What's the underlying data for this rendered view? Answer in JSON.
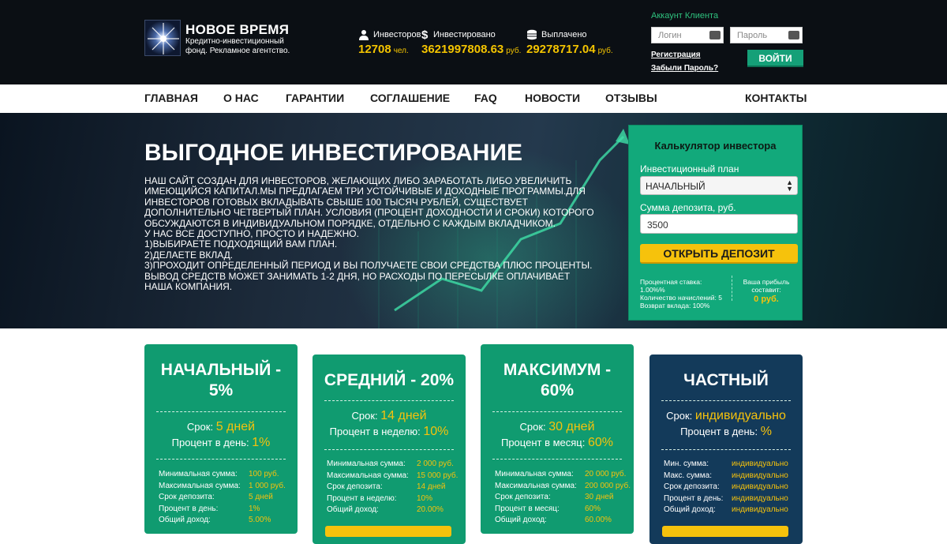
{
  "header": {
    "logo_title": "НОВОЕ ВРЕМЯ",
    "logo_subtitle": "Кредитно-инвестиционный фонд. Рекламное агентство.",
    "stats": [
      {
        "icon": "user-icon",
        "label": "Инвесторов",
        "value": "12708",
        "unit": "чел."
      },
      {
        "icon": "dollar-icon",
        "label": "Инвестировано",
        "value": "3621997808.63",
        "unit": "руб."
      },
      {
        "icon": "coins-icon",
        "label": "Выплачено",
        "value": "29278717.04",
        "unit": "руб."
      }
    ],
    "account": {
      "title": "Аккаунт Клиента",
      "login_placeholder": "Логин",
      "password_placeholder": "Пароль",
      "register_link": "Регистрация",
      "forgot_link": "Забыли Пароль?",
      "login_button": "ВОЙТИ"
    }
  },
  "nav": {
    "items": [
      "ГЛАВНАЯ",
      "О НАС",
      "ГАРАНТИИ",
      "СОГЛАШЕНИЕ",
      "FAQ",
      "НОВОСТИ",
      "ОТЗЫВЫ",
      "КОНТАКТЫ"
    ]
  },
  "hero": {
    "title": "ВЫГОДНОЕ ИНВЕСТИРОВАНИЕ",
    "text": "НАШ САЙТ СОЗДАН ДЛЯ ИНВЕСТОРОВ, ЖЕЛАЮЩИХ ЛИБО ЗАРАБОТАТЬ ЛИБО УВЕЛИЧИТЬ\nИМЕЮЩИЙСЯ КАПИТАЛ.МЫ ПРЕДЛАГАЕМ ТРИ УСТОЙЧИВЫЕ И ДОХОДНЫЕ ПРОГРАММЫ.ДЛЯ\nИНВЕСТОРОВ ГОТОВЫХ ВКЛАДЫВАТЬ СВЫШЕ 100 ТЫСЯЧ РУБЛЕЙ, СУЩЕСТВУЕТ\nДОПОЛНИТЕЛЬНО ЧЕТВЕРТЫЙ ПЛАН. УСЛОВИЯ (ПРОЦЕНТ ДОХОДНОСТИ И СРОКИ) КОТОРОГО\nОБСУЖДАЮТСЯ В ИНДИВИДУАЛЬНОМ ПОРЯДКЕ, ОТДЕЛЬНО С КАЖДЫМ ВКЛАДЧИКОМ.\nУ НАС ВСЕ ДОСТУПНО, ПРОСТО И НАДЕЖНО.\n1)ВЫБИРАЕТЕ ПОДХОДЯЩИЙ ВАМ ПЛАН.\n2)ДЕЛАЕТЕ ВКЛАД.\n3)ПРОХОДИТ ОПРЕДЕЛЕННЫЙ ПЕРИОД И ВЫ ПОЛУЧАЕТЕ СВОИ СРЕДСТВА ПЛЮС ПРОЦЕНТЫ.\nВЫВОД СРЕДСТВ МОЖЕТ ЗАНИМАТЬ 1-2 ДНЯ, НО РАСХОДЫ ПО ПЕРЕСЫЛКЕ ОПЛАЧИВАЕТ\nНАША КОМПАНИЯ."
  },
  "calculator": {
    "title": "Калькулятор инвестора",
    "plan_label": "Инвестиционный план",
    "plan_selected": "НАЧАЛЬНЫЙ",
    "sum_label": "Сумма депозита, руб.",
    "sum_value": "3500",
    "button": "ОТКРЫТЬ ДЕПОЗИТ",
    "info": [
      "Процентная ставка: 1.00%%",
      "Количество начислений: 5",
      "Возврат вклада: 100%"
    ],
    "profit_label": "Ваша прибыль составит:",
    "profit_value": "0 руб."
  },
  "plans": [
    {
      "color": "#109b70",
      "title": "НАЧАЛЬНЫЙ - 5%",
      "term_label": "Срок:",
      "term_value": "5 дней",
      "rate_label": "Процент в день:",
      "rate_value": "1%",
      "rows": [
        {
          "k": "Минимальная сумма:",
          "v": "100 руб."
        },
        {
          "k": "Максимальная сумма:",
          "v": "1 000 руб."
        },
        {
          "k": "Срок депозита:",
          "v": "5 дней"
        },
        {
          "k": "Процент в день:",
          "v": "1%"
        },
        {
          "k": "Общий доход:",
          "v": "5.00%"
        }
      ]
    },
    {
      "color": "#109b70",
      "title": "СРЕДНИЙ - 20%",
      "term_label": "Срок:",
      "term_value": "14 дней",
      "rate_label": "Процент в неделю:",
      "rate_value": "10%",
      "rows": [
        {
          "k": "Минимальная сумма:",
          "v": "2 000 руб."
        },
        {
          "k": "Максимальная сумма:",
          "v": "15 000 руб."
        },
        {
          "k": "Срок депозита:",
          "v": "14 дней"
        },
        {
          "k": "Процент в неделю:",
          "v": "10%"
        },
        {
          "k": "Общий доход:",
          "v": "20.00%"
        }
      ]
    },
    {
      "color": "#109b70",
      "title": "МАКСИМУМ - 60%",
      "term_label": "Срок:",
      "term_value": "30 дней",
      "rate_label": "Процент в месяц:",
      "rate_value": "60%",
      "rows": [
        {
          "k": "Минимальная сумма:",
          "v": "20 000 руб."
        },
        {
          "k": "Максимальная сумма:",
          "v": "200 000 руб."
        },
        {
          "k": "Срок депозита:",
          "v": "30 дней"
        },
        {
          "k": "Процент в месяц:",
          "v": "60%"
        },
        {
          "k": "Общий доход:",
          "v": "60.00%"
        }
      ]
    },
    {
      "color": "#133a5a",
      "title": "ЧАСТНЫЙ",
      "term_label": "Срок:",
      "term_value": "индивидуально",
      "rate_label": "Процент в день:",
      "rate_value": "%",
      "rows": [
        {
          "k": "Мин. сумма:",
          "v": "индивидуально"
        },
        {
          "k": "Макс. сумма:",
          "v": "индивидуально"
        },
        {
          "k": "Срок депозита:",
          "v": "индивидуально"
        },
        {
          "k": "Процент в день:",
          "v": "индивидуально"
        },
        {
          "k": "Общий доход:",
          "v": "индивидуально"
        }
      ]
    }
  ]
}
